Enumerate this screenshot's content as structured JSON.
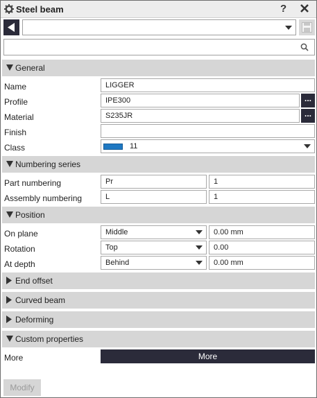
{
  "window": {
    "title": "Steel beam",
    "help_label": "?"
  },
  "toolbar": {
    "preset_value": "",
    "search_placeholder": ""
  },
  "sections": {
    "general": "General",
    "numbering": "Numbering series",
    "position": "Position",
    "end_offset": "End offset",
    "curved_beam": "Curved beam",
    "deforming": "Deforming",
    "custom_properties": "Custom properties"
  },
  "general": {
    "name_label": "Name",
    "name_value": "LIGGER",
    "profile_label": "Profile",
    "profile_value": "IPE300",
    "material_label": "Material",
    "material_value": "S235JR",
    "finish_label": "Finish",
    "finish_value": "",
    "class_label": "Class",
    "class_value": "11",
    "class_color": "#1e78c2",
    "browse_label": "..."
  },
  "numbering": {
    "part_label": "Part numbering",
    "part_prefix": "Pr",
    "part_start": "1",
    "assembly_label": "Assembly numbering",
    "assembly_prefix": "L",
    "assembly_start": "1"
  },
  "position": {
    "on_plane_label": "On plane",
    "on_plane_value": "Middle",
    "on_plane_offset": "0.00 mm",
    "rotation_label": "Rotation",
    "rotation_value": "Top",
    "rotation_offset": "0.00",
    "at_depth_label": "At depth",
    "at_depth_value": "Behind",
    "at_depth_offset": "0.00 mm"
  },
  "custom": {
    "more_label": "More",
    "more_button": "More"
  },
  "footer": {
    "modify_button": "Modify"
  },
  "colors": {
    "accent_dark": "#2b2b3a",
    "section_bg": "#d6d6d6"
  }
}
